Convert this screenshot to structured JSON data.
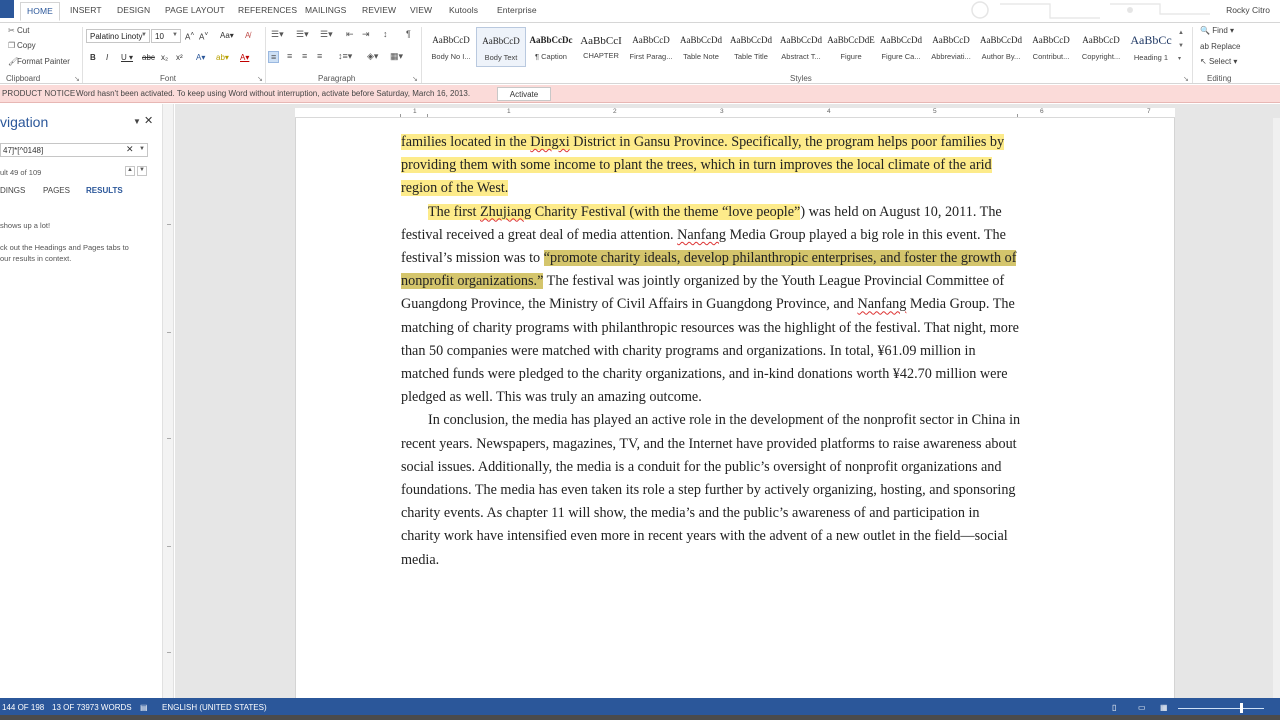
{
  "ribbon_tabs": [
    "HOME",
    "INSERT",
    "DESIGN",
    "PAGE LAYOUT",
    "REFERENCES",
    "MAILINGS",
    "REVIEW",
    "VIEW",
    "Kutools",
    "Enterprise"
  ],
  "active_tab": "HOME",
  "user_name": "Rocky Citro",
  "clipboard": {
    "cut": "Cut",
    "copy": "Copy",
    "format_painter": "Format Painter",
    "group_label": "Clipboard"
  },
  "font": {
    "name": "Palatino Linoty",
    "size": "10",
    "group_label": "Font"
  },
  "paragraph": {
    "group_label": "Paragraph"
  },
  "styles": {
    "group_label": "Styles",
    "items": [
      {
        "preview": "AaBbCcD",
        "name": "Body No I..."
      },
      {
        "preview": "AaBbCcD",
        "name": "Body Text"
      },
      {
        "preview": "AaBbCcDc",
        "name": "¶ Caption"
      },
      {
        "preview": "AaBbCcI",
        "name": "CHAPTER"
      },
      {
        "preview": "AaBbCcD",
        "name": "First Parag..."
      },
      {
        "preview": "AaBbCcDd",
        "name": "Table Note"
      },
      {
        "preview": "AaBbCcDd",
        "name": "Table Title"
      },
      {
        "preview": "AaBbCcDd",
        "name": "Abstract T..."
      },
      {
        "preview": "AaBbCcDdE",
        "name": "Figure"
      },
      {
        "preview": "AaBbCcDd",
        "name": "Figure Ca..."
      },
      {
        "preview": "AaBbCcD",
        "name": "Abbreviati..."
      },
      {
        "preview": "AaBbCcDd",
        "name": "Author By..."
      },
      {
        "preview": "AaBbCcD",
        "name": "Contribut..."
      },
      {
        "preview": "AaBbCcD",
        "name": "Copyright..."
      },
      {
        "preview": "AaBbCc",
        "name": "Heading 1"
      }
    ],
    "selected_index": 1
  },
  "editing": {
    "find": "Find",
    "replace": "Replace",
    "select": "Select",
    "group_label": "Editing"
  },
  "notice": {
    "title": "PRODUCT NOTICE",
    "text": "Word hasn't been activated. To keep using Word without interruption, activate before Saturday, March 16, 2013.",
    "button": "Activate"
  },
  "navigation": {
    "title": "vigation",
    "search_value": "47]*[^0148]",
    "result_text": "ult 49 of 109",
    "tabs": [
      "DINGS",
      "PAGES",
      "RESULTS"
    ],
    "active_tab": "RESULTS",
    "message1": "shows up a lot!",
    "message2_line1": "ck out the Headings and Pages tabs to",
    "message2_line2": "our results in context."
  },
  "ruler_numbers": [
    "1",
    "1",
    "2",
    "3",
    "4",
    "5",
    "6",
    "7"
  ],
  "document": {
    "p1": {
      "hl": "families located in the ",
      "w1": "Dingxi",
      "rest": " District in Gansu Province. Specifically, the program helps poor families by providing them with some income to plant the trees, which in turn improves the local climate of the arid region of the West. "
    },
    "p2": {
      "hl_a": "The first ",
      "w1": "Zhujiang",
      "hl_b": " Charity Festival (with the theme “love people”",
      "t1": ") was held on August 10, 2011. The festival received a great deal of media attention. ",
      "w2": "Nanfang",
      "t2": " Media Group played a big role in this event. The festival’s mission was to ",
      "hl2": "“promote charity ideals, develop philanthropic enterprises, and foster the growth of nonprofit organizations.”",
      "t3": " The festival was jointly organized by the Youth League Provincial Committee of Guangdong Province, the Ministry of Civil Affairs in Guangdong Province, and ",
      "w3": "Nanfang",
      "t4": " Media Group. The matching of charity programs with philanthropic resources was the highlight of the festival. That night, more than 50 companies were matched with charity programs and organizations. In total, ¥61.09 million in matched funds were pledged to the charity organizations, and in-kind donations worth ¥42.70 million were pledged as well. This was truly an amazing outcome."
    },
    "p3": "In conclusion, the media has played an active role in the development of the nonprofit sector in China in recent years. Newspapers, magazines, TV, and the Internet have provided platforms to raise awareness about social issues. Additionally, the media is a conduit for the public’s oversight of nonprofit organizations and foundations. The media has even taken its role a step further by actively organizing, hosting, and sponsoring charity events. As chapter 11 will show, the media’s and the public’s awareness of and participation in charity work have intensified even more in recent years with the advent of a new outlet in the field—social media."
  },
  "status": {
    "page": "144 OF 198",
    "words": "13 OF 73973 WORDS",
    "language": "ENGLISH (UNITED STATES)"
  },
  "zoom_level": 0.72,
  "colors": {
    "accent": "#2b579a",
    "highlight": "#fdeb8a",
    "highlight_dark": "#d4c56c",
    "notice_bg": "#fbdbd9"
  }
}
